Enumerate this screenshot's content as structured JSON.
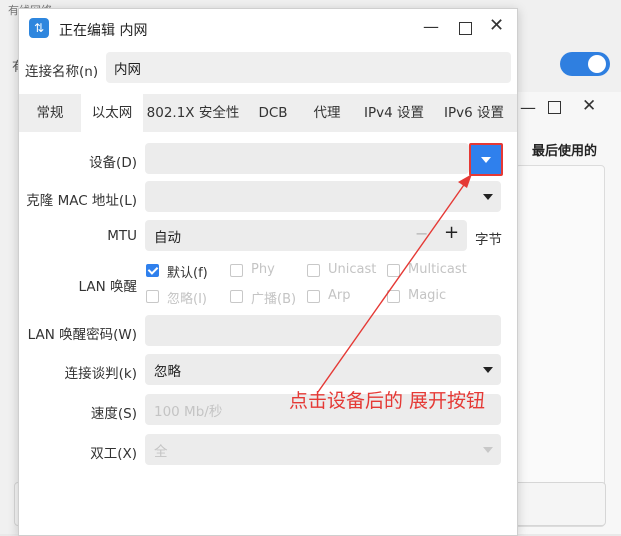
{
  "background": {
    "title": "有线网络",
    "side_label": "有",
    "column_header": "最后使用的"
  },
  "dialog": {
    "icon_glyph": "⇅",
    "title": "正在编辑 内网",
    "connection_name_label": "连接名称(n)",
    "connection_name_value": "内网"
  },
  "tabs": [
    "常规",
    "以太网",
    "802.1X 安全性",
    "DCB",
    "代理",
    "IPv4 设置",
    "IPv6 设置"
  ],
  "active_tab": "以太网",
  "ethernet": {
    "device_label": "设备(D)",
    "device_value": "",
    "clone_mac_label": "克隆 MAC 地址(L)",
    "clone_mac_value": "",
    "mtu_label": "MTU",
    "mtu_value": "自动",
    "mtu_unit": "字节",
    "wol_label": "LAN 唤醒",
    "wol_options": [
      {
        "label": "默认(f)",
        "checked": true,
        "enabled": true
      },
      {
        "label": "Phy",
        "checked": false,
        "enabled": false
      },
      {
        "label": "Unicast",
        "checked": false,
        "enabled": false
      },
      {
        "label": "Multicast",
        "checked": false,
        "enabled": false
      },
      {
        "label": "忽略(I)",
        "checked": false,
        "enabled": false
      },
      {
        "label": "广播(B)",
        "checked": false,
        "enabled": false
      },
      {
        "label": "Arp",
        "checked": false,
        "enabled": false
      },
      {
        "label": "Magic",
        "checked": false,
        "enabled": false
      }
    ],
    "wol_password_label": "LAN 唤醒密码(W)",
    "wol_password_value": "",
    "negotiation_label": "连接谈判(k)",
    "negotiation_value": "忽略",
    "speed_label": "速度(S)",
    "speed_value": "100 Mb/秒",
    "duplex_label": "双工(X)",
    "duplex_value": "全"
  },
  "annotation": {
    "text": "点击设备后的 展开按钮",
    "color": "#e53935"
  },
  "colors": {
    "accent": "#2f80ed",
    "highlight": "#e53935"
  }
}
